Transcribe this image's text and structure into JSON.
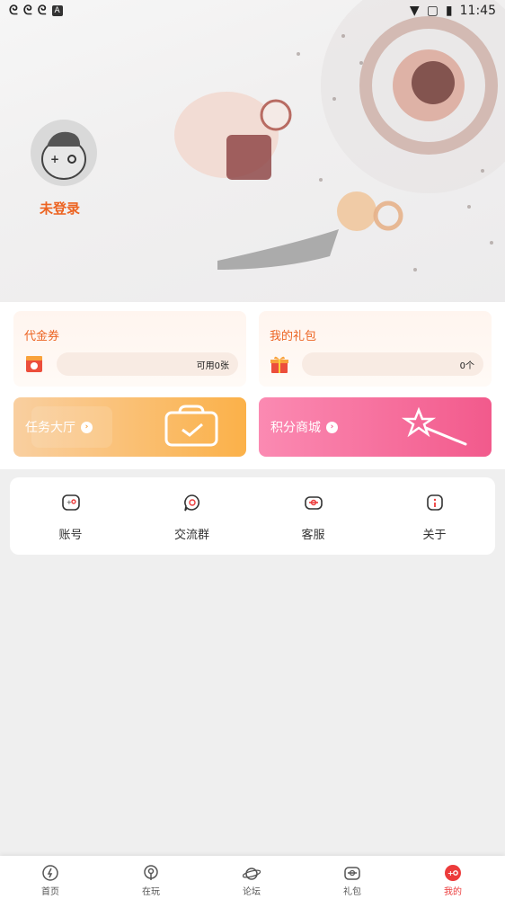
{
  "status_bar": {
    "time": "11:45"
  },
  "profile": {
    "login_text": "未登录"
  },
  "cards": {
    "voucher": {
      "title": "代金券",
      "value": "可用0张"
    },
    "gift": {
      "title": "我的礼包",
      "value": "0个"
    }
  },
  "banners": {
    "task_hall": {
      "label": "任务大厅"
    },
    "points_mall": {
      "label": "积分商城"
    }
  },
  "menu": [
    {
      "label": "账号",
      "icon": "account-icon"
    },
    {
      "label": "交流群",
      "icon": "chat-group-icon"
    },
    {
      "label": "客服",
      "icon": "customer-service-icon"
    },
    {
      "label": "关于",
      "icon": "about-icon"
    }
  ],
  "nav": [
    {
      "label": "首页",
      "icon": "home-icon"
    },
    {
      "label": "在玩",
      "icon": "playing-icon"
    },
    {
      "label": "论坛",
      "icon": "forum-icon"
    },
    {
      "label": "礼包",
      "icon": "gift-icon"
    },
    {
      "label": "我的",
      "icon": "me-icon",
      "active": true
    }
  ],
  "colors": {
    "accent": "#ec6321",
    "nav_active": "#ec3b3b",
    "task_banner": "#fbb149",
    "mall_banner": "#f76394"
  }
}
